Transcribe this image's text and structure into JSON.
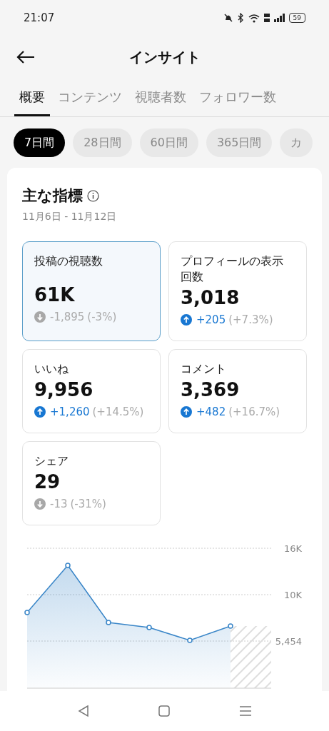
{
  "status_bar": {
    "time": "21:07",
    "battery": "59"
  },
  "header": {
    "title": "インサイト"
  },
  "tabs": [
    {
      "label": "概要",
      "selected": true
    },
    {
      "label": "コンテンツ",
      "selected": false
    },
    {
      "label": "視聴者数",
      "selected": false
    },
    {
      "label": "フォロワー数",
      "selected": false
    }
  ],
  "periods": [
    {
      "label": "7日間",
      "selected": true
    },
    {
      "label": "28日間",
      "selected": false
    },
    {
      "label": "60日間",
      "selected": false
    },
    {
      "label": "365日間",
      "selected": false
    },
    {
      "label": "カ",
      "selected": false
    }
  ],
  "summary": {
    "title": "主な指標",
    "date_range": "11月6日 - 11月12日",
    "metrics": [
      {
        "label": "投稿の視聴数",
        "value": "61K",
        "kind": "down",
        "change": "-1,895",
        "percent": "(-3%)",
        "selected": true
      },
      {
        "label": "プロフィールの表示回数",
        "value": "3,018",
        "kind": "up",
        "change": "+205",
        "percent": "(+7.3%)",
        "selected": false
      },
      {
        "label": "いいね",
        "value": "9,956",
        "kind": "up",
        "change": "+1,260",
        "percent": "(+14.5%)",
        "selected": false
      },
      {
        "label": "コメント",
        "value": "3,369",
        "kind": "up",
        "change": "+482",
        "percent": "(+16.7%)",
        "selected": false
      },
      {
        "label": "シェア",
        "value": "29",
        "kind": "down",
        "change": "-13",
        "percent": "(-31%)",
        "selected": false
      }
    ],
    "trend_chart": {
      "y_labels": [
        "16K",
        "10K",
        "5,454"
      ]
    }
  }
}
